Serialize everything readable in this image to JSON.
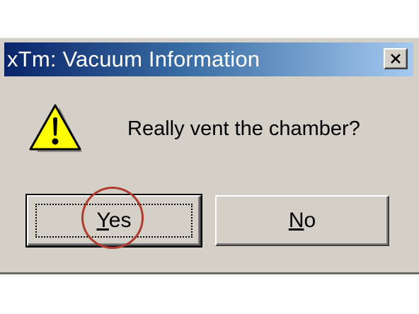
{
  "window": {
    "title": "xTm: Vacuum Information",
    "close_icon": "close-icon"
  },
  "message": {
    "icon": "warning-icon",
    "text": "Really vent the chamber?"
  },
  "buttons": {
    "yes": {
      "hotkey": "Y",
      "rest": "es",
      "focused": true
    },
    "no": {
      "hotkey": "N",
      "rest": "o"
    }
  },
  "annotation": {
    "highlight_target": "yes-button",
    "color": "#b03a2e"
  },
  "colors": {
    "title_gradient_start": "#0a246a",
    "title_gradient_end": "#a6caf0",
    "dialog_face": "#d4d0c8",
    "warning_fill": "#ffff00"
  }
}
